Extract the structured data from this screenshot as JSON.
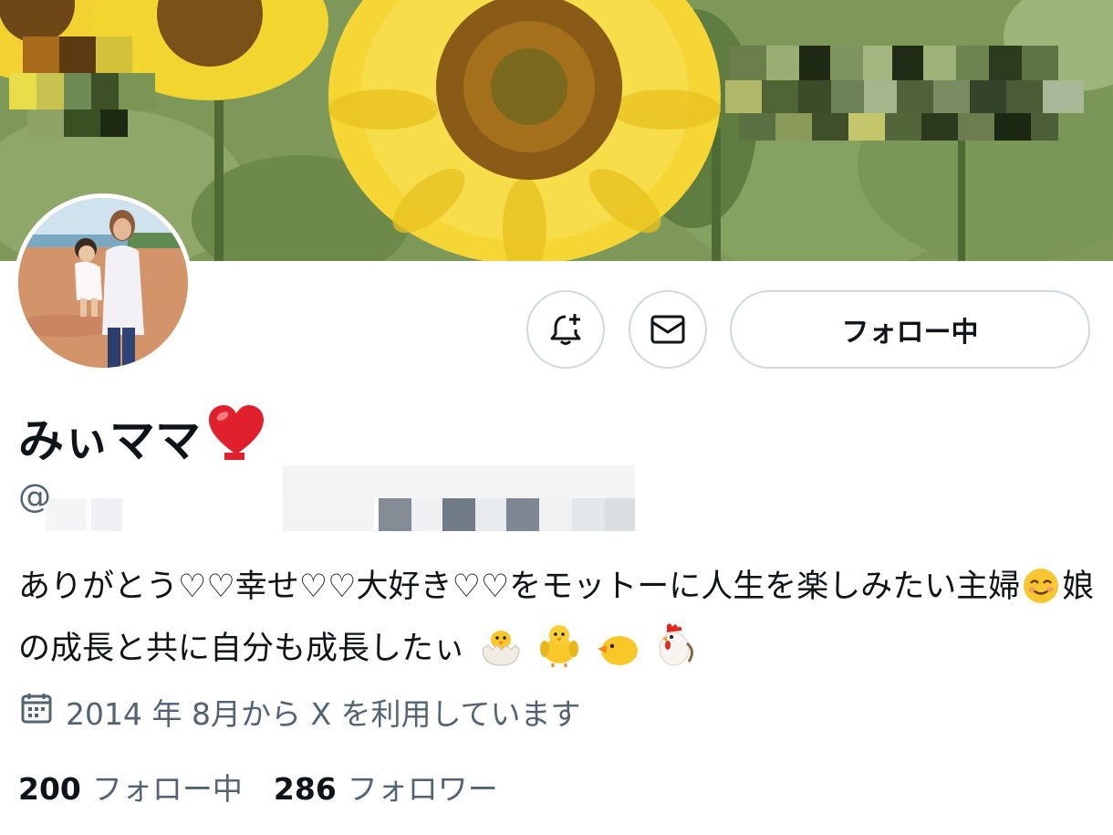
{
  "profile": {
    "display_name": "みぃママ",
    "handle_prefix": "@",
    "bio_part1": "ありがとう♡♡幸せ♡♡大好き♡♡をモットーに人生を楽しみたい主婦",
    "bio_part2": "娘の成長と共に自分も成長したぃ",
    "joined": "2014 年 8月から X を利用しています"
  },
  "actions": {
    "follow_label": "フォロー中"
  },
  "stats": {
    "following_count": "200",
    "following_label": "フォロー中",
    "followers_count": "286",
    "followers_label": "フォロワー"
  },
  "icons": {
    "notify": "bell-plus-icon",
    "message": "envelope-icon",
    "calendar": "calendar-icon",
    "name_emoji": "red-heart",
    "bio_emojis": [
      "smiling-face",
      "hatching-chick",
      "front-facing-chick",
      "baby-chick",
      "rooster"
    ]
  },
  "colors": {
    "text_primary": "#0f1419",
    "text_secondary": "#536471",
    "border": "#cfd9de"
  }
}
